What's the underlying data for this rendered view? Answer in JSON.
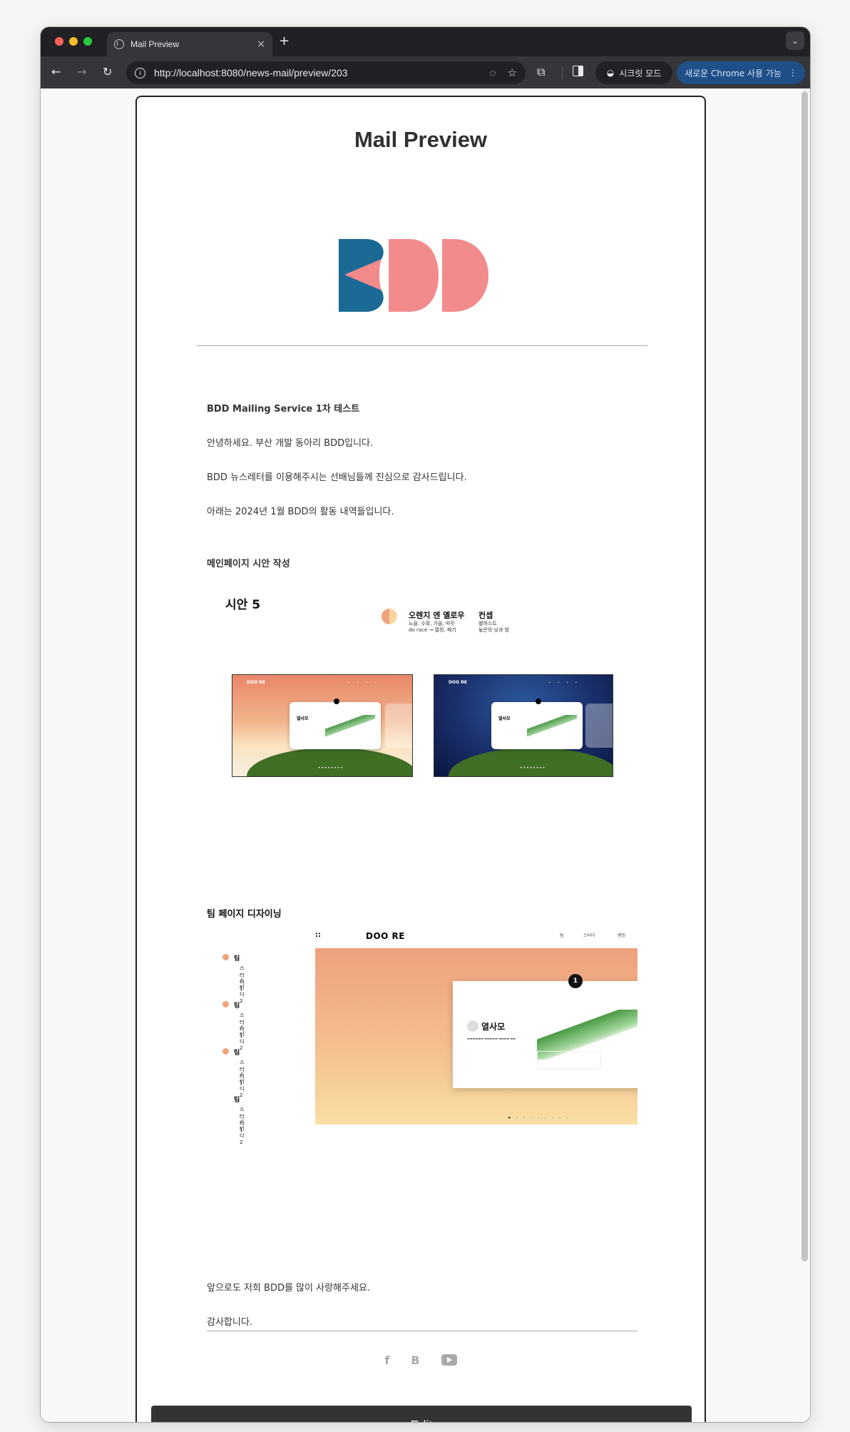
{
  "browser": {
    "tab_title": "Mail Preview",
    "tab_close": "×",
    "new_tab": "+",
    "tab_menu": "⌄",
    "url": "http://localhost:8080/news-mail/preview/203",
    "incognito_label": "시크릿 모드",
    "update_label": "새로운 Chrome 사용 가능",
    "update_menu": "⋮"
  },
  "page": {
    "title": "Mail Preview",
    "edit_button": "Edit"
  },
  "mail": {
    "heading": "BDD Mailing Service 1차 테스트",
    "greeting": "안녕하세요. 부산 개발 동아리 BDD입니다.",
    "thanks": "BDD 뉴스레터를 이용해주시는 선배님들께 진심으로 감사드립니다.",
    "intro": "아래는 2024년 1월 BDD의 활동 내역들입니다.",
    "section1_title": "메인페이지 시안 작성",
    "section2_title": "팀 페이지 디자이닝",
    "closing": "앞으로도 저희 BDD를 많이 사랑해주세요.",
    "signoff": "감사합니다."
  },
  "draft": {
    "title": "시안 5",
    "legend_a_title": "오렌지 엔 옐로우",
    "legend_a_line1": "노을, 수확, 가을, 따듯",
    "legend_a_line2": "do race → 열정, 패기",
    "legend_b_title": "컨셉",
    "legend_b_line1": "별하스트",
    "legend_b_line2": "높은의 낮과 밤",
    "shot_logo": "DOO RE",
    "shot_card_title": "열사모"
  },
  "team_mock": {
    "groups": [
      {
        "label": "팀",
        "sub1": "스터디1",
        "sub2": "스터디2"
      },
      {
        "label": "팀",
        "sub1": "스터디1",
        "sub2": "스터디2"
      },
      {
        "label": "팀",
        "sub1": "스터디1",
        "sub2": "스터디2"
      },
      {
        "label": "팀",
        "sub1": "스터디1",
        "sub2": "스터디2"
      }
    ],
    "icon": "::",
    "logo": "DOO RE",
    "nav": [
      "팀",
      "스터디",
      "랭킹"
    ],
    "card_title": "열사모",
    "badge": "1"
  },
  "colors": {
    "logo_blue": "#1b6a96",
    "logo_pink": "#f28b8c",
    "button_dark": "#333333"
  },
  "icons": [
    "facebook-icon",
    "blog-icon",
    "youtube-icon"
  ]
}
